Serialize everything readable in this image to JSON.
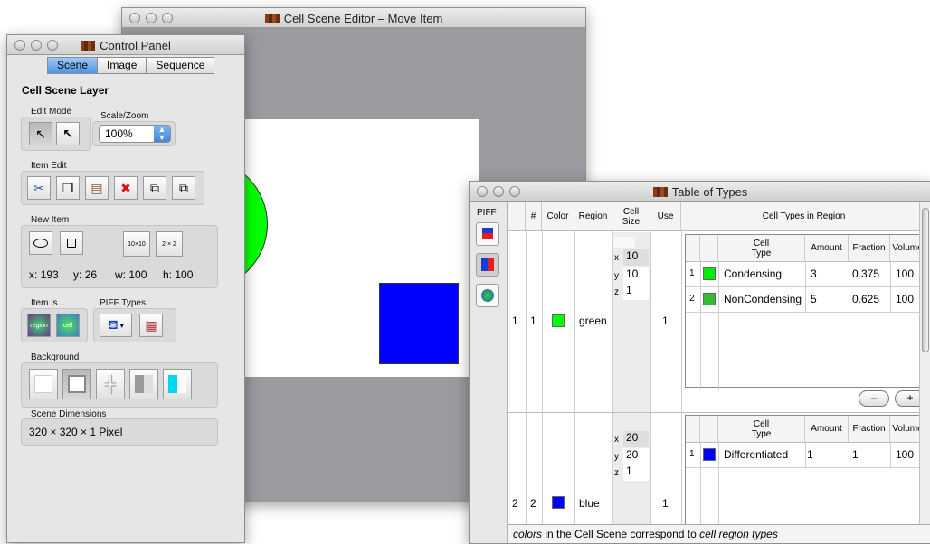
{
  "editor": {
    "title": "Cell Scene Editor – Move Item"
  },
  "control": {
    "title": "Control Panel",
    "tabs": [
      "Scene",
      "Image",
      "Sequence"
    ],
    "heading": "Cell Scene Layer",
    "edit_mode_label": "Edit Mode",
    "scale_label": "Scale/Zoom",
    "scale_value": "100%",
    "item_edit_label": "Item Edit",
    "new_item_label": "New Item",
    "new_item_10x10": "10×10",
    "new_item_2x2": "2 × 2",
    "coords": {
      "x_label": "x:",
      "x": "193",
      "y_label": "y:",
      "y": "26",
      "w_label": "w:",
      "w": "100",
      "h_label": "h:",
      "h": "100"
    },
    "item_is_label": "Item is...",
    "region_label": "region",
    "cell_label": "cell",
    "piff_types_label": "PIFF Types",
    "background_label": "Background",
    "scene_dims_label": "Scene Dimensions",
    "scene_dims_value": "320  ×  320  ×  1 Pixel"
  },
  "types": {
    "title": "Table of Types",
    "piff_label": "PIFF",
    "headers": {
      "num": "#",
      "color": "Color",
      "region": "Region",
      "cell_size": "Cell Size",
      "use": "Use",
      "cell_types": "Cell Types in Region"
    },
    "sub_headers": {
      "cell_type": "Cell Type",
      "amount": "Amount",
      "fraction": "Fraction",
      "volume": "Volume"
    },
    "regions": [
      {
        "row": "1",
        "num": "1",
        "color": "#00ff00",
        "name": "green",
        "size_x": "10",
        "size_y": "10",
        "size_z": "1",
        "use": "1",
        "types": [
          {
            "idx": "1",
            "color": "#00ee00",
            "name": "Condensing",
            "amount": "3",
            "fraction": "0.375",
            "volume": "100"
          },
          {
            "idx": "2",
            "color": "#33bb33",
            "name": "NonCondensing",
            "amount": "5",
            "fraction": "0.625",
            "volume": "100"
          }
        ]
      },
      {
        "row": "2",
        "num": "2",
        "color": "#0000ff",
        "name": "blue",
        "size_x": "20",
        "size_y": "20",
        "size_z": "1",
        "use": "1",
        "types": [
          {
            "idx": "1",
            "color": "#0000ff",
            "name": "Differentiated",
            "amount": "1",
            "fraction": "1",
            "volume": "100"
          }
        ]
      }
    ],
    "axis": {
      "x": "x",
      "y": "y",
      "z": "z"
    },
    "minus_label": "–",
    "plus_label": "+",
    "status": {
      "em1": "colors",
      "mid": " in the Cell Scene correspond to ",
      "em2": "cell region types"
    }
  }
}
